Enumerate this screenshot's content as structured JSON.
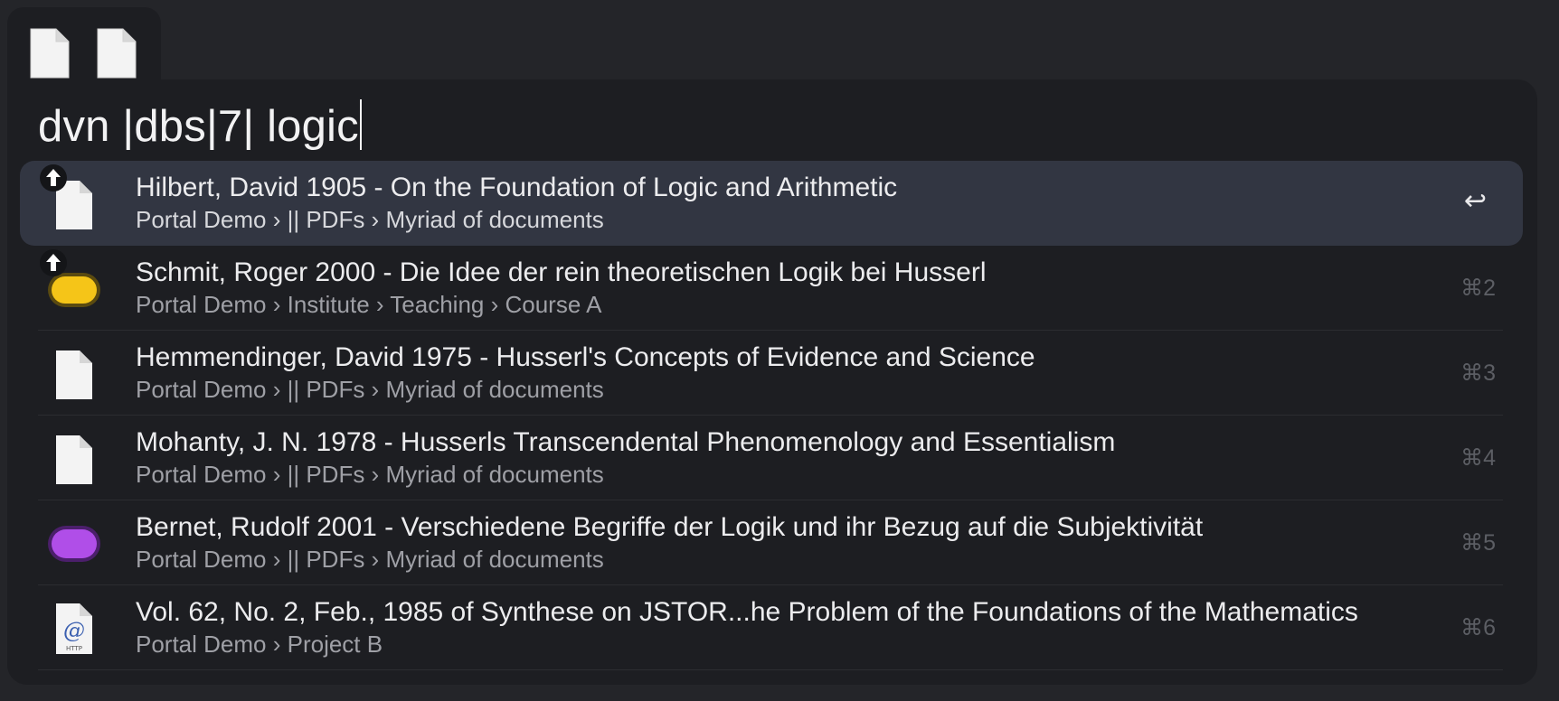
{
  "search": {
    "query": "dvn |dbs|7| logic"
  },
  "tabs": [
    {
      "icon": "document-icon"
    },
    {
      "icon": "document-icon"
    }
  ],
  "results": [
    {
      "title": "Hilbert, David 1905 - On the Foundation of Logic and Arithmetic",
      "path": "Portal Demo › || PDFs › Myriad of documents",
      "shortcut": "↩",
      "icon": "document-icon",
      "upload_badge": true,
      "selected": true
    },
    {
      "title": "Schmit, Roger 2000 - Die Idee der rein theoretischen Logik bei Husserl",
      "path": "Portal Demo › Institute › Teaching › Course A",
      "shortcut": "⌘2",
      "icon": "yellow-pill-icon",
      "icon_color": "#f5c518",
      "upload_badge": true
    },
    {
      "title": "Hemmendinger, David 1975 - Husserl's Concepts of Evidence and Science",
      "path": "Portal Demo › || PDFs › Myriad of documents",
      "shortcut": "⌘3",
      "icon": "document-icon"
    },
    {
      "title": "Mohanty, J. N. 1978 - Husserls Transcendental Phenomenology and Essentialism",
      "path": "Portal Demo › || PDFs › Myriad of documents",
      "shortcut": "⌘4",
      "icon": "document-icon"
    },
    {
      "title": "Bernet, Rudolf 2001 - Verschiedene Begriffe der Logik und ihr Bezug auf die Subjektivität",
      "path": "Portal Demo › || PDFs › Myriad of documents",
      "shortcut": "⌘5",
      "icon": "purple-pill-icon",
      "icon_color": "#b04ee8"
    },
    {
      "title": "Vol. 62, No. 2, Feb., 1985 of Synthese on JSTOR...he Problem of the Foundations of the Mathematics",
      "path": "Portal Demo › Project B",
      "shortcut": "⌘6",
      "icon": "http-link-icon",
      "icon_caption": "HTTP"
    }
  ]
}
